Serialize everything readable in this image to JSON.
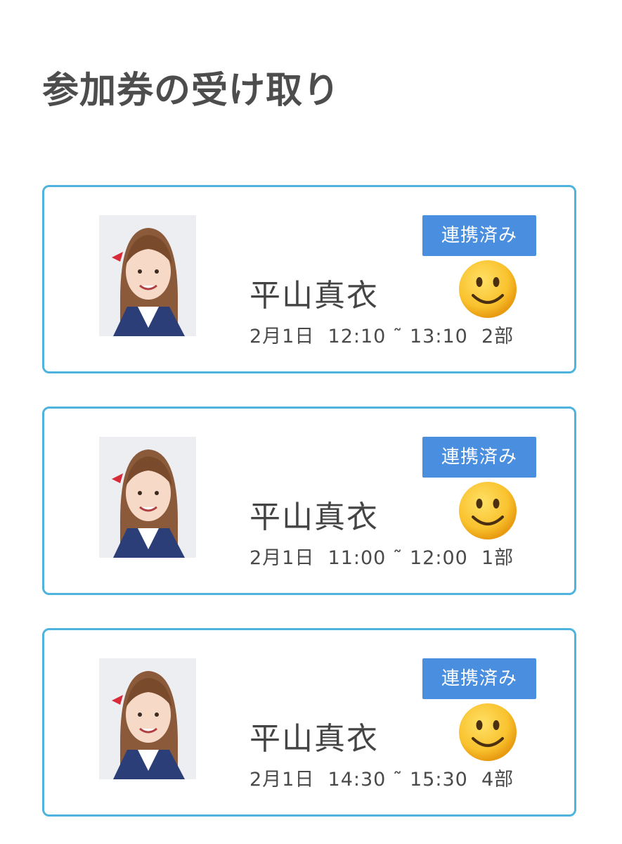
{
  "header": {
    "title": "参加券の受け取り"
  },
  "tickets": [
    {
      "name": "平山真衣",
      "schedule": "2月1日  12:10 ˜ 13:10  2部",
      "status": "連携済み",
      "emoji": "smiley-face-icon"
    },
    {
      "name": "平山真衣",
      "schedule": "2月1日  11:00 ˜ 12:00  1部",
      "status": "連携済み",
      "emoji": "smiley-face-icon"
    },
    {
      "name": "平山真衣",
      "schedule": "2月1日  14:30 ˜ 15:30  4部",
      "status": "連携済み",
      "emoji": "smiley-face-icon"
    }
  ],
  "colors": {
    "card_border": "#4fb4dd",
    "badge_bg": "#4a8ee0",
    "title_text": "#4d4d4d"
  }
}
